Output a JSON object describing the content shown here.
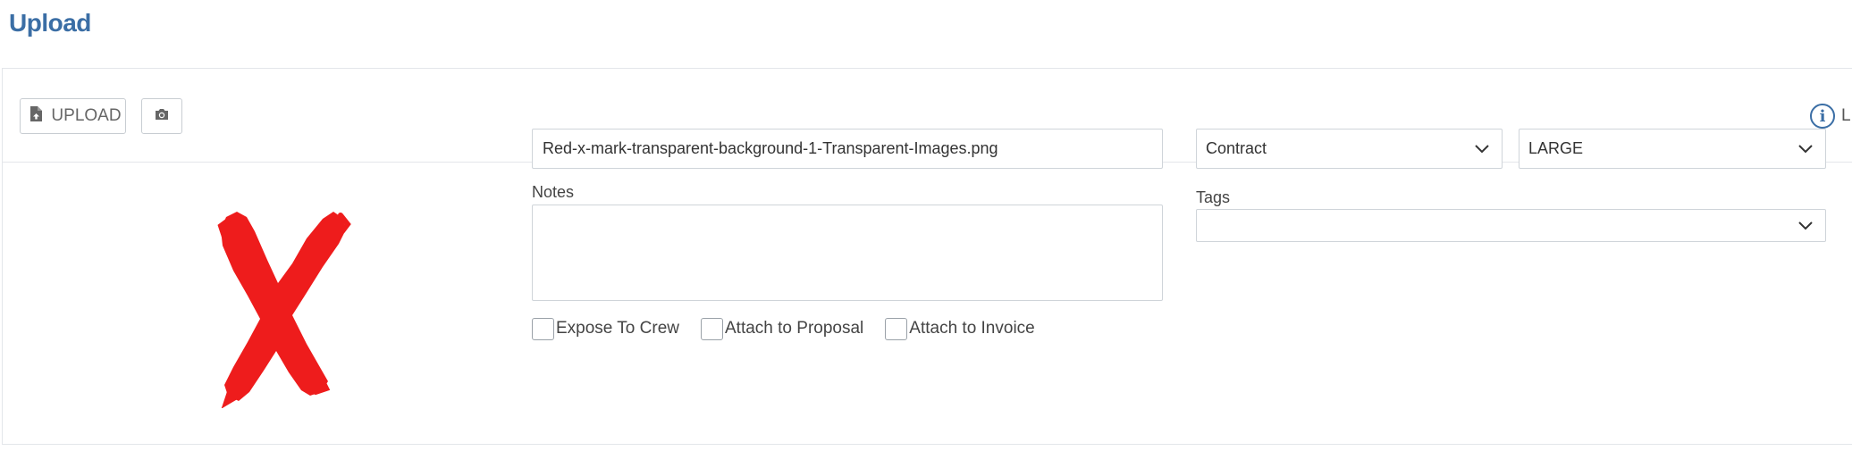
{
  "page": {
    "title": "Upload"
  },
  "toolbar": {
    "upload_label": "UPLOAD",
    "upload_icon": "file-upload-icon",
    "camera_icon": "camera-icon",
    "info_icon": "info-icon",
    "info_text": "L"
  },
  "preview": {
    "image_description_icon": "red-x-mark-image",
    "color": "#ee1c1c"
  },
  "form": {
    "filename_value": "Red-x-mark-transparent-background-1-Transparent-Images.png",
    "notes_label": "Notes",
    "notes_value": "",
    "document_type_value": "Contract",
    "size_value": "LARGE",
    "tags_label": "Tags",
    "tags_value": "",
    "checkboxes": [
      {
        "label": "Expose To Crew",
        "checked": false
      },
      {
        "label": "Attach to Proposal",
        "checked": false
      },
      {
        "label": "Attach to Invoice",
        "checked": false
      }
    ]
  },
  "colors": {
    "accent": "#3b6ea5",
    "border": "#cfd4d9"
  }
}
